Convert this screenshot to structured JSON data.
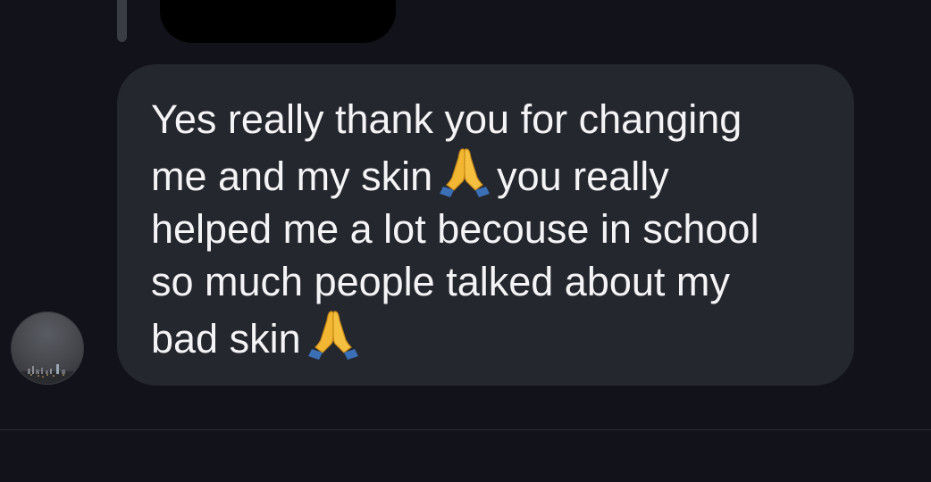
{
  "conversation": {
    "previous_message": {
      "text": ""
    },
    "message": {
      "lines": [
        {
          "text": "Yes really thank you for changing"
        },
        {
          "before": "me and my skin",
          "emoji": "folded-hands-icon",
          "after": "you really"
        },
        {
          "text": "helped me a lot becouse in school"
        },
        {
          "text": "so much people talked about my"
        },
        {
          "before": "bad skin",
          "emoji": "folded-hands-icon",
          "after": ""
        }
      ],
      "emoji_symbol": "🙏"
    },
    "sender": {
      "avatar": "avatar-city-skyline"
    }
  },
  "colors": {
    "background": "#12131a",
    "bubble": "#25272e",
    "text": "#f4f4f6",
    "emoji": "#f2b632",
    "emoji_cuff": "#3b6fb6"
  }
}
